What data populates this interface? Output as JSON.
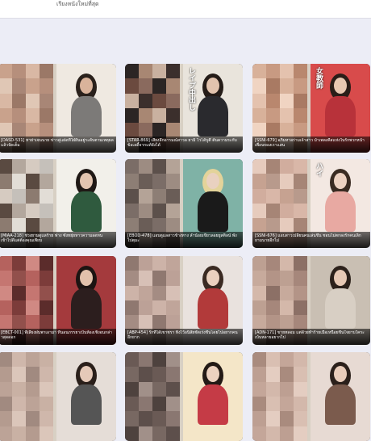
{
  "header": {
    "sort_label": "เรียงหนังใหม่ที่สุด"
  },
  "videos": [
    {
      "title": "[DASD-531] หาย่าเจนนาย ข่าวคู่แฝดที่ใฝ่ฝันอยู่ระดับตามเหตุผลแล้วจัดเต็ม"
    },
    {
      "title": "[STAR-869] เสียงลึกอารมณ์สาวล ยามิ ไวโด้บูตี้ ต้นความระกับข้อเลดี้จากแท้ยังได้"
    },
    {
      "title": "[SSNI-679] อภิมหาอร่ามเจ้าสาว ม้าเพลงคีสแห่งในรักพวกหนำเพื่อนของเราแสน"
    },
    {
      "title": "[MIAA-218] ช่วงยามดูแลร้าย ฟาง ซั่งหยุ่ยหาวความอดทน เข้าไปดีแต่ต้องคุณเพียบ"
    },
    {
      "title": "[EBOD-478] แอบดูแลสาวข้างทาง ลำน้อยเขียวลอยยูสติลน์ พัง ไปตุมะ"
    },
    {
      "title": "[SSNI-676] แอบสาวเปลี่ยนคนเล่นขึ้น ชอนไม่ตกลงรักคนเลิกยามนายอีกไม่"
    },
    {
      "title": "[EBCT-001] พี่เลี้ยงฝนพาเอามา ที่นอนภรรยาเป็นห้องเชิงอนกล่าวสุดดอก"
    },
    {
      "title": "[ABP-454] รักที่ได้เขาชรา ทิ้งไว้อนิสัยชัดเร่งขึ้นโดยไปอยากคนอีกยาก"
    },
    {
      "title": "[ADN-171] ขายหลอม แต่ด้วยทำร้ายเมื่อเหนื่อยขึ้นใจยาบใคระเบ้นหลายอยากไป"
    },
    {
      "title": ""
    },
    {
      "title": ""
    },
    {
      "title": ""
    }
  ],
  "badges": {
    "card2": "レイプ中出し",
    "card3": "女教師",
    "card6": "ハイ"
  }
}
